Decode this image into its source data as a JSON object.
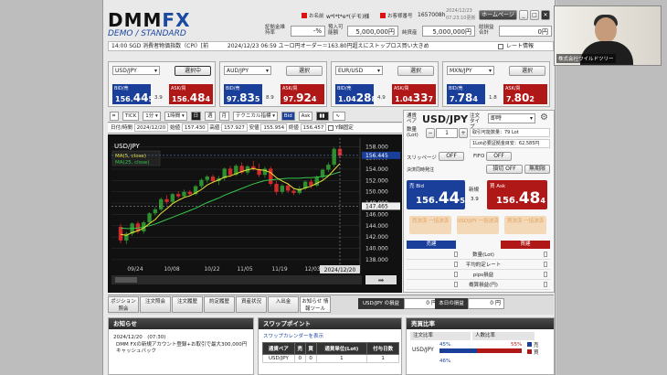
{
  "header": {
    "logo_main": "DMM",
    "logo_fx": "FX",
    "logo_sub": "DEMO / STANDARD",
    "name_label": "お名前",
    "name_value": "w*l*t*e*(デモ)様",
    "customer_label": "お客様番号",
    "customer_value": "1657008h",
    "datetime": "2024/12/23",
    "time": "07:23:10更新",
    "home_button": "ホームページ",
    "margin_label": "証拠金維持率",
    "margin_value": "-%",
    "valuation_label": "評価損益",
    "valuation_value": "",
    "deposit_label": "預入可能額",
    "deposit_value": "5,000,000円",
    "net_label": "純資産",
    "net_value": "5,000,000円",
    "pl_label": "総損益合計",
    "pl_value": "0円",
    "ticker_left": "14:00 SGD 消費者物価指数（CPI）[前",
    "ticker_main": "2024/12/23 06:59 ユーロ円オーダー＝163.80円超えにストップロス買い大きめ",
    "rate_info": "レート情報"
  },
  "rate_panels": [
    {
      "pair": "USD/JPY",
      "button": "選択中",
      "bid_pre": "156.",
      "bid_big": "44",
      "bid_last": "5",
      "spread": "3.9",
      "ask_pre": "156.",
      "ask_big": "48",
      "ask_last": "4",
      "selected": true
    },
    {
      "pair": "AUD/JPY",
      "button": "選択",
      "bid_pre": "97.",
      "bid_big": "83",
      "bid_last": "5",
      "spread": "8.9",
      "ask_pre": "97.",
      "ask_big": "92",
      "ask_last": "4",
      "selected": false
    },
    {
      "pair": "EUR/USD",
      "button": "選択",
      "bid_pre": "1.04",
      "bid_big": "28",
      "bid_last": "8",
      "spread": "4.9",
      "ask_pre": "1.04",
      "ask_big": "33",
      "ask_last": "7",
      "selected": false
    },
    {
      "pair": "MXN/JPY",
      "button": "選択",
      "bid_pre": "7.",
      "bid_big": "78",
      "bid_last": "4",
      "spread": "1.8",
      "ask_pre": "7.",
      "ask_big": "80",
      "ask_last": "2",
      "selected": false
    }
  ],
  "chart_toolbar": {
    "tick": "TICK",
    "interval": "1分",
    "span": "1時間",
    "day": "日",
    "week": "週",
    "month": "月",
    "tech": "テクニカル指標",
    "bid": "Bid",
    "ask": "Ask"
  },
  "chart_info": {
    "date_label": "日付/時間",
    "date": "2024/12/20",
    "open_label": "始値",
    "open": "157.430",
    "high_label": "高値",
    "high": "157.927",
    "low_label": "安値",
    "low": "155.954",
    "close_label": "終値",
    "close": "156.457",
    "fixed_label": "Y軸固定"
  },
  "chart_data": {
    "type": "candlestick",
    "symbol": "USD/JPY",
    "legend": [
      "MA(5, close)",
      "MA(25, close)"
    ],
    "x_ticks": [
      "09/24",
      "10/08",
      "10/22",
      "11/05",
      "11/19",
      "12/03",
      "2024/12/20"
    ],
    "y_ticks": [
      "158.000",
      "156.000",
      "154.000",
      "152.000",
      "150.000",
      "148.000",
      "146.000",
      "144.000",
      "142.000",
      "140.000",
      "138.000"
    ],
    "ylim": [
      137.5,
      159.5
    ],
    "current_price": "156.445",
    "crosshair_price": "147.465",
    "colors": {
      "up": "#2f8f2f",
      "down": "#d22b2b",
      "ma5": "#e8e33a",
      "ma25": "#35c74a",
      "bg": "#111111"
    },
    "candles": [
      {
        "o": 143.8,
        "h": 144.3,
        "l": 140.9,
        "c": 141.4
      },
      {
        "o": 141.4,
        "h": 142.9,
        "l": 140.8,
        "c": 142.6
      },
      {
        "o": 142.6,
        "h": 144.6,
        "l": 142.2,
        "c": 144.4
      },
      {
        "o": 144.4,
        "h": 144.8,
        "l": 142.6,
        "c": 143.0
      },
      {
        "o": 143.0,
        "h": 144.9,
        "l": 142.6,
        "c": 144.6
      },
      {
        "o": 144.6,
        "h": 146.4,
        "l": 144.2,
        "c": 146.2
      },
      {
        "o": 146.2,
        "h": 147.3,
        "l": 145.8,
        "c": 146.9
      },
      {
        "o": 146.9,
        "h": 149.0,
        "l": 146.6,
        "c": 148.7
      },
      {
        "o": 148.7,
        "h": 149.4,
        "l": 147.8,
        "c": 148.2
      },
      {
        "o": 148.2,
        "h": 149.8,
        "l": 147.9,
        "c": 149.6
      },
      {
        "o": 149.6,
        "h": 150.1,
        "l": 148.8,
        "c": 149.2
      },
      {
        "o": 149.2,
        "h": 150.4,
        "l": 148.9,
        "c": 150.0
      },
      {
        "o": 150.0,
        "h": 150.3,
        "l": 149.2,
        "c": 149.6
      },
      {
        "o": 149.6,
        "h": 151.2,
        "l": 149.4,
        "c": 151.0
      },
      {
        "o": 151.0,
        "h": 152.4,
        "l": 150.6,
        "c": 152.1
      },
      {
        "o": 152.1,
        "h": 153.0,
        "l": 151.6,
        "c": 152.7
      },
      {
        "o": 152.7,
        "h": 153.1,
        "l": 151.5,
        "c": 151.9
      },
      {
        "o": 151.9,
        "h": 152.8,
        "l": 151.2,
        "c": 152.4
      },
      {
        "o": 152.4,
        "h": 154.3,
        "l": 152.0,
        "c": 154.1
      },
      {
        "o": 154.1,
        "h": 154.6,
        "l": 152.6,
        "c": 153.0
      },
      {
        "o": 153.0,
        "h": 154.9,
        "l": 152.8,
        "c": 154.6
      },
      {
        "o": 154.6,
        "h": 155.2,
        "l": 153.1,
        "c": 153.4
      },
      {
        "o": 153.4,
        "h": 154.7,
        "l": 153.0,
        "c": 154.5
      },
      {
        "o": 154.5,
        "h": 155.5,
        "l": 153.7,
        "c": 154.0
      },
      {
        "o": 154.0,
        "h": 155.0,
        "l": 152.6,
        "c": 153.0
      },
      {
        "o": 153.0,
        "h": 154.4,
        "l": 152.5,
        "c": 154.1
      },
      {
        "o": 154.1,
        "h": 154.5,
        "l": 151.0,
        "c": 151.4
      },
      {
        "o": 151.4,
        "h": 151.9,
        "l": 149.5,
        "c": 150.0
      },
      {
        "o": 150.0,
        "h": 151.4,
        "l": 149.6,
        "c": 151.1
      },
      {
        "o": 151.1,
        "h": 151.6,
        "l": 149.8,
        "c": 150.2
      },
      {
        "o": 150.2,
        "h": 150.7,
        "l": 149.4,
        "c": 149.8
      },
      {
        "o": 149.8,
        "h": 151.0,
        "l": 149.5,
        "c": 150.6
      },
      {
        "o": 150.6,
        "h": 152.0,
        "l": 150.3,
        "c": 151.8
      },
      {
        "o": 151.8,
        "h": 152.3,
        "l": 150.6,
        "c": 151.1
      },
      {
        "o": 151.1,
        "h": 152.9,
        "l": 150.9,
        "c": 152.6
      },
      {
        "o": 152.6,
        "h": 154.1,
        "l": 152.2,
        "c": 153.9
      },
      {
        "o": 153.9,
        "h": 155.2,
        "l": 153.5,
        "c": 154.8
      },
      {
        "o": 154.8,
        "h": 157.9,
        "l": 154.4,
        "c": 157.6
      },
      {
        "o": 157.6,
        "h": 157.9,
        "l": 155.9,
        "c": 156.4
      }
    ],
    "ma5": [
      142.5,
      142.3,
      142.8,
      143.1,
      143.6,
      144.4,
      145.1,
      146.2,
      147.0,
      147.9,
      148.5,
      149.0,
      149.3,
      149.8,
      150.4,
      151.2,
      151.7,
      152.1,
      152.6,
      152.8,
      153.2,
      153.6,
      153.9,
      154.1,
      153.9,
      153.8,
      153.4,
      152.5,
      151.9,
      151.4,
      150.6,
      150.3,
      150.7,
      151.0,
      151.5,
      152.0,
      152.8,
      153.9,
      155.0
    ],
    "ma25": [
      143.6,
      143.5,
      143.5,
      143.6,
      143.8,
      144.0,
      144.3,
      144.7,
      145.1,
      145.5,
      145.9,
      146.3,
      146.7,
      147.1,
      147.6,
      148.1,
      148.5,
      148.9,
      149.4,
      149.8,
      150.2,
      150.6,
      151.0,
      151.4,
      151.7,
      152.0,
      152.1,
      152.2,
      152.3,
      152.4,
      152.4,
      152.4,
      152.5,
      152.5,
      152.6,
      152.7,
      152.9,
      153.2,
      153.5
    ]
  },
  "order": {
    "pair_label": "通貨ペア",
    "pair": "USD/JPY",
    "type_label": "注文タイプ",
    "type": "即時",
    "qty_label": "数量(Lot)",
    "qty": "1",
    "max_label": "取引可能数量：79 Lot",
    "req_label": "1Lot必要証拠金目安：62,585円",
    "slip_label": "スリッページ",
    "slip_value": "OFF",
    "fifo_label": "FIFO",
    "fifo_value": "OFF",
    "settle_label": "決済同時発注",
    "settle_value": "損切 OFF",
    "unlimited": "無期限",
    "bid_label": "売 Bid",
    "ask_label": "買 Ask",
    "new_label": "新規",
    "spread": "3.9",
    "bid_pre": "156.",
    "bid_big": "44",
    "bid_last": "5",
    "ask_pre": "156.",
    "ask_big": "48",
    "ask_last": "4",
    "settle_sell": "売決済 一括決済",
    "settle_all": "USD/JPY 一括決済",
    "settle_buy": "買決済 一括決済",
    "sell_head": "売建",
    "buy_head": "買建",
    "rows": [
      "数量(Lot)",
      "平均約定レート",
      "pips損益",
      "概算損益(円)"
    ]
  },
  "bottom_tabs": {
    "tabs": [
      "ポジション照会",
      "注文照会",
      "注文履歴",
      "約定履歴",
      "資産状況",
      "入出金",
      "お知らせ 情報ツール"
    ],
    "pl_label": "USD/JPY の損益",
    "pl_value": "0 円",
    "today_label": "本日の損益",
    "today_value": "0 円"
  },
  "news": {
    "title": "お知らせ",
    "date": "2024/12/20　(07:30)",
    "text": "DMM FXの新規アカウント登録+お取引で最大300,000円キャッシュバック"
  },
  "swap": {
    "title": "スワップポイント",
    "link": "スワップカレンダーを表示",
    "headers": [
      "通貨ペア",
      "売",
      "買",
      "通貨単位(Lot)",
      "付与日数"
    ],
    "rows": [
      [
        "USD/JPY",
        "0",
        "0",
        "1",
        "1"
      ]
    ]
  },
  "ratio": {
    "title": "売買比率",
    "col1": "注文比率",
    "col2": "人数比率",
    "pair": "USD/JPY",
    "sell_pct": "45%",
    "buy_pct": "55%",
    "sell_label": "売",
    "buy_label": "買",
    "sell_fraction": 0.45,
    "row2_pct": "46%"
  },
  "webcam": {
    "caption": "株式会社ワイルドツリー"
  }
}
